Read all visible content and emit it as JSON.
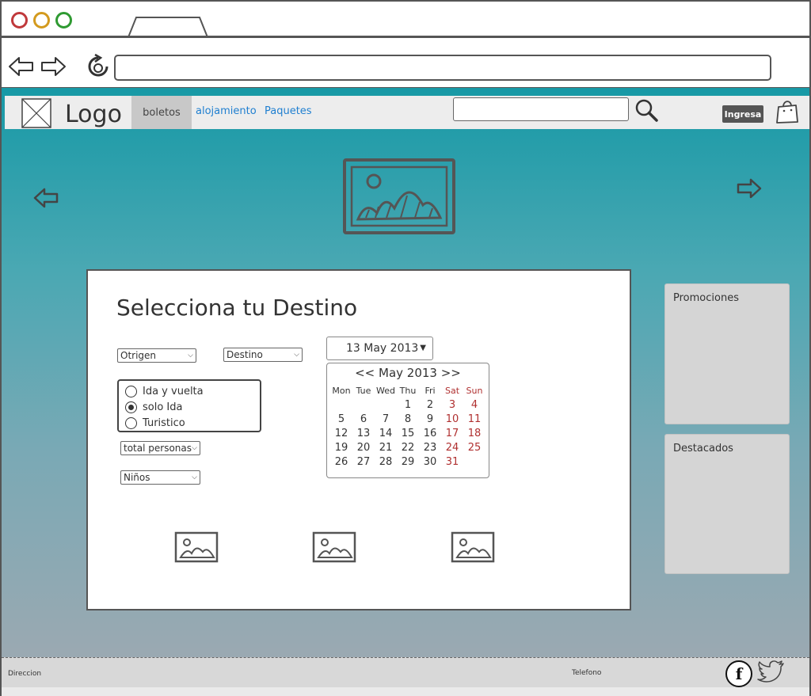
{
  "app": {
    "logo": "Logo",
    "nav": {
      "active": "boletos",
      "links": [
        "alojamiento",
        "Paquetes"
      ]
    },
    "search": {
      "value": "",
      "placeholder": ""
    },
    "login_label": "Ingresa"
  },
  "booking": {
    "title": "Selecciona tu Destino",
    "origin": "Otrigen",
    "destination": "Destino",
    "trip_types": [
      {
        "label": "Ida y vuelta",
        "selected": false
      },
      {
        "label": "solo Ida",
        "selected": true
      },
      {
        "label": "Turistico",
        "selected": false
      }
    ],
    "persons": "total personas",
    "children": "Niños",
    "date": "13 May 2013",
    "calendar": {
      "header": "<< May 2013 >>",
      "weekdays": [
        "Mon",
        "Tue",
        "Wed",
        "Thu",
        "Fri",
        "Sat",
        "Sun"
      ],
      "leading_blanks": 3,
      "days": 31
    }
  },
  "sidebar": {
    "promos": "Promociones",
    "featured": "Destacados"
  },
  "footer": {
    "address": "Direccion",
    "phone": "Telefono"
  },
  "colors": {
    "link": "#1f7fd0",
    "weekend": "#b03030"
  }
}
